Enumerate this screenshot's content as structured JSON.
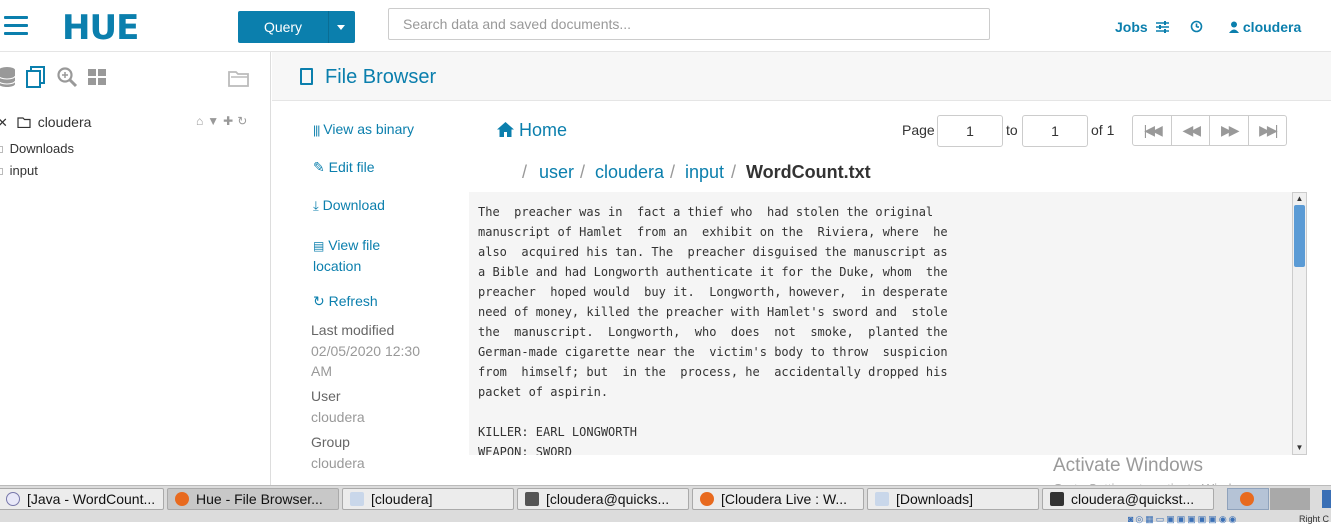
{
  "app": {
    "logo": "HUE",
    "query_label": "Query",
    "search_placeholder": "Search data and saved documents...",
    "jobs_label": "Jobs",
    "user_label": "cloudera"
  },
  "sidebar": {
    "root_label": "cloudera",
    "items": [
      {
        "label": "Downloads"
      },
      {
        "label": "input"
      }
    ]
  },
  "header": {
    "title": "File Browser"
  },
  "actions": {
    "view_binary": "View as binary",
    "edit_file": "Edit file",
    "download": "Download",
    "view_location_1": "View file",
    "view_location_2": "location",
    "refresh": "Refresh"
  },
  "meta": {
    "last_modified_label": "Last modified",
    "last_modified_value_1": "02/05/2020 12:30",
    "last_modified_value_2": "AM",
    "user_label": "User",
    "user_value": "cloudera",
    "group_label": "Group",
    "group_value": "cloudera"
  },
  "nav": {
    "home": "Home",
    "page_label": "Page",
    "page_from": "1",
    "to_label": "to",
    "page_to": "1",
    "of_label": "of 1"
  },
  "breadcrumb": {
    "sep": "/",
    "items": [
      "user",
      "cloudera",
      "input"
    ],
    "current": "WordCount.txt"
  },
  "file": {
    "content": "The  preacher was in  fact a thief who  had stolen the original\nmanuscript of Hamlet  from an  exhibit on the  Riviera, where  he\nalso  acquired his tan. The  preacher disguised the manuscript as\na Bible and had Longworth authenticate it for the Duke, whom  the\npreacher  hoped would  buy it.  Longworth, however,  in desperate\nneed of money, killed the preacher with Hamlet's sword and  stole\nthe  manuscript.  Longworth,  who  does  not  smoke,  planted the\nGerman-made cigarette near the  victim's body to throw  suspicion\nfrom  himself; but  in the  process, he  accidentally dropped his\npacket of aspirin.\n\nKILLER: EARL LONGWORTH\nWEAPON: SWORD"
  },
  "watermark": {
    "title": "Activate Windows",
    "subtitle": "Go to Settings to activate Windows."
  },
  "taskbar": {
    "tasks": [
      {
        "label": "[Java - WordCount..."
      },
      {
        "label": "Hue - File Browser..."
      },
      {
        "label": "[cloudera]"
      },
      {
        "label": "[cloudera@quicks..."
      },
      {
        "label": "[Cloudera Live : W..."
      },
      {
        "label": "[Downloads]"
      },
      {
        "label": "cloudera@quickst..."
      }
    ],
    "tray_text": "Right C"
  }
}
